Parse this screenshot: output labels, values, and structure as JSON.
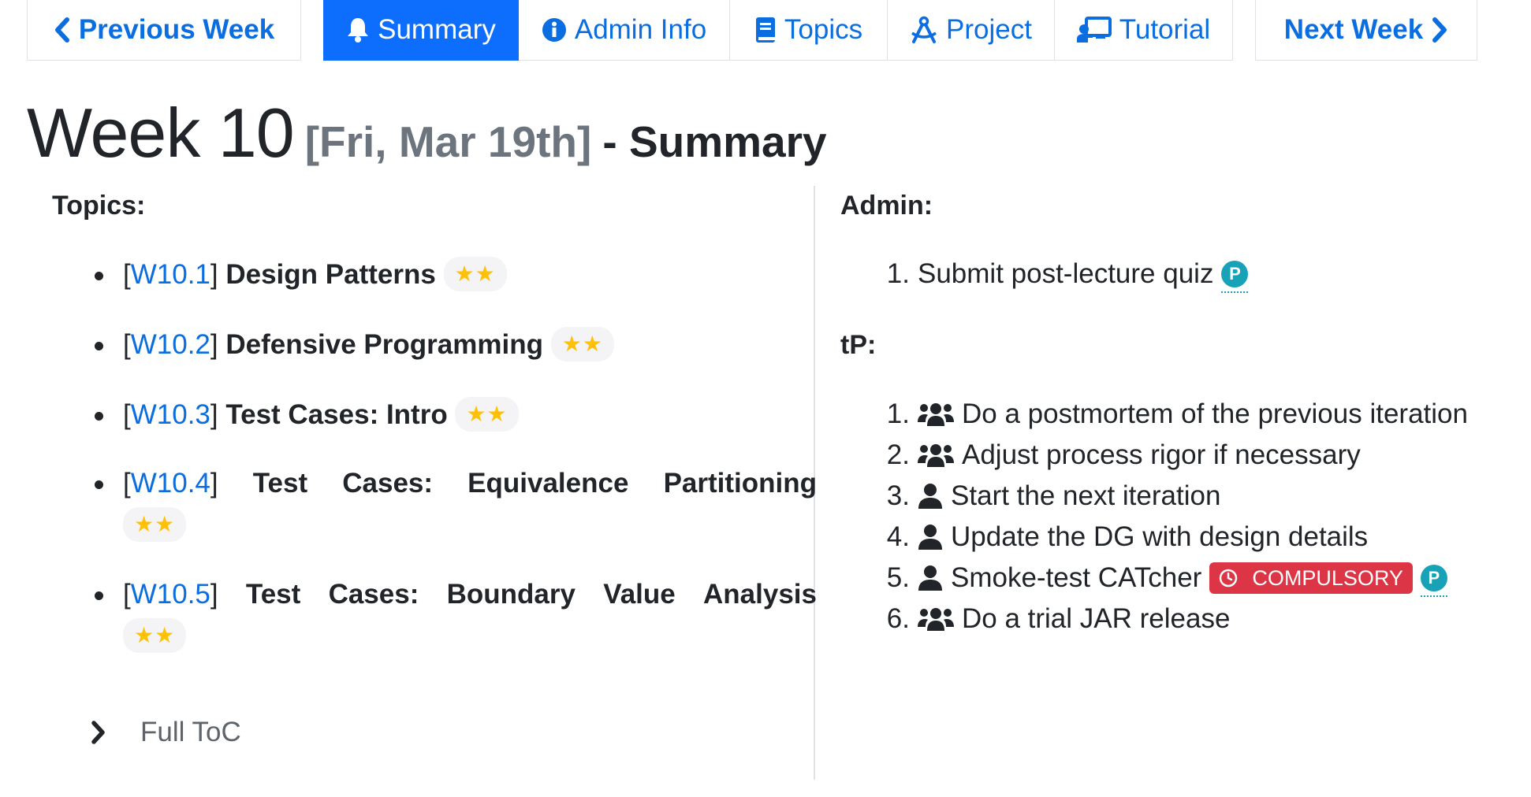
{
  "nav": {
    "previous_label": "Previous Week",
    "tabs": [
      {
        "label": "Summary",
        "icon": "bell-icon",
        "active": true
      },
      {
        "label": "Admin Info",
        "icon": "info-circle-icon",
        "active": false
      },
      {
        "label": "Topics",
        "icon": "book-icon",
        "active": false
      },
      {
        "label": "Project",
        "icon": "drafting-compass-icon",
        "active": false
      },
      {
        "label": "Tutorial",
        "icon": "chalkboard-teacher-icon",
        "active": false
      }
    ],
    "next_label": "Next Week"
  },
  "heading": {
    "week": "Week 10",
    "date": "[Fri, Mar 19th]",
    "suffix": "- Summary"
  },
  "topics": {
    "label": "Topics:",
    "items": [
      {
        "code": "W10.1",
        "title": "Design Patterns",
        "stars": "★★"
      },
      {
        "code": "W10.2",
        "title": "Defensive Programming",
        "stars": "★★"
      },
      {
        "code": "W10.3",
        "title": "Test Cases: Intro",
        "stars": "★★"
      },
      {
        "code": "W10.4",
        "title_words": [
          "Test",
          "Cases:",
          "Equivalence",
          "Partitioning"
        ],
        "stars": "★★"
      },
      {
        "code": "W10.5",
        "title_words": [
          "Test",
          "Cases:",
          "Boundary",
          "Value",
          "Analysis"
        ],
        "stars": "★★"
      }
    ],
    "full_toc": "Full ToC"
  },
  "admin": {
    "label": "Admin:",
    "items": [
      {
        "num": "1.",
        "text": "Submit post-lecture quiz",
        "badge": "P"
      }
    ]
  },
  "tp": {
    "label": "tP:",
    "items": [
      {
        "num": "1.",
        "icon": "users-icon",
        "text": "Do a postmortem of the previous iteration"
      },
      {
        "num": "2.",
        "icon": "users-icon",
        "text": "Adjust process rigor if necessary"
      },
      {
        "num": "3.",
        "icon": "user-icon",
        "text": "Start the next iteration"
      },
      {
        "num": "4.",
        "icon": "user-icon",
        "text": "Update the DG with design details"
      },
      {
        "num": "5.",
        "icon": "user-icon",
        "text": "Smoke-test CATcher",
        "tag": "COMPULSORY",
        "badge": "P"
      },
      {
        "num": "6.",
        "icon": "users-icon",
        "text": "Do a trial JAR release"
      }
    ]
  },
  "colors": {
    "link": "#0a6de0",
    "active_tab": "#0d6efd",
    "star": "#ffc107",
    "badge": "#17a2b8",
    "compulsory": "#dc3545"
  }
}
